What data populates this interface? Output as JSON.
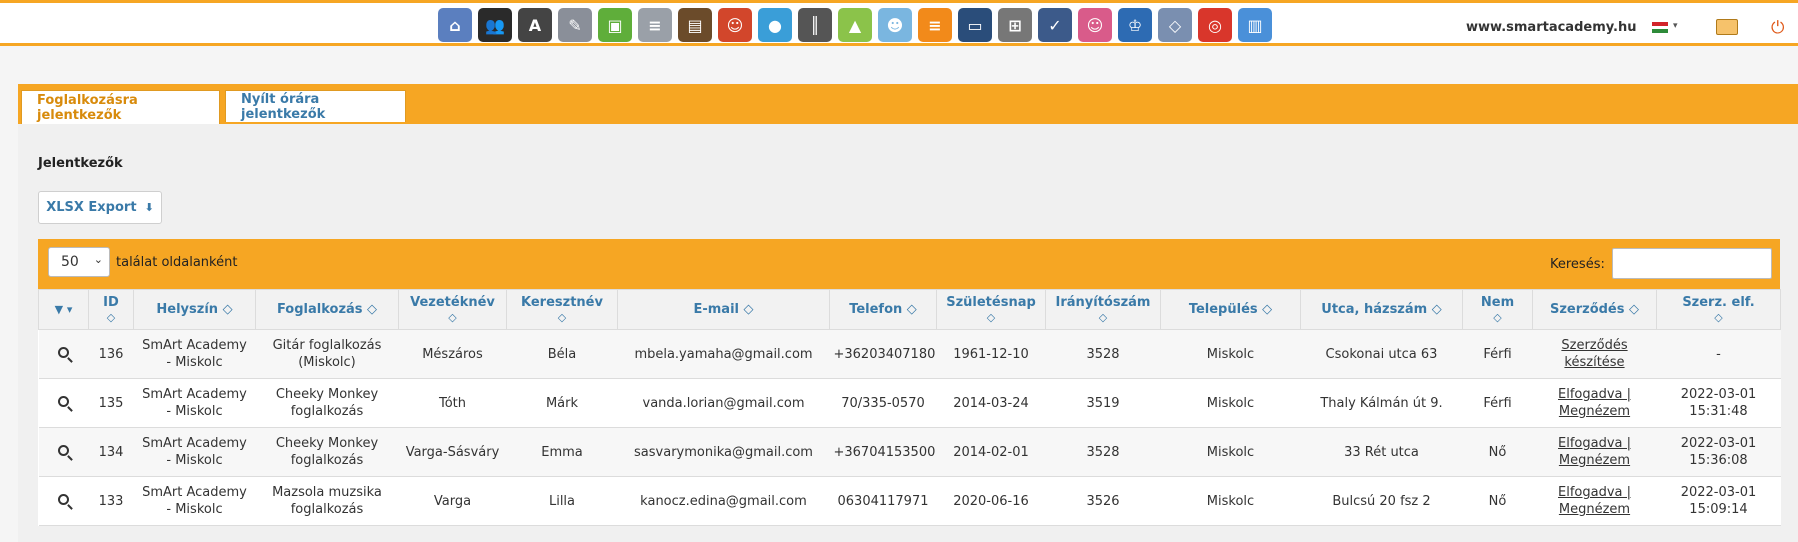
{
  "topbar": {
    "site_url": "www.smartacademy.hu",
    "icons": [
      {
        "name": "school-icon",
        "glyph": "⌂",
        "color": "#5b7fbf"
      },
      {
        "name": "group-icon",
        "glyph": "👥",
        "color": "#2a2a2a"
      },
      {
        "name": "translate-icon",
        "glyph": "A",
        "color": "#444444"
      },
      {
        "name": "notebook-icon",
        "glyph": "✎",
        "color": "#8a8f99"
      },
      {
        "name": "slides-icon",
        "glyph": "▣",
        "color": "#5fae3a"
      },
      {
        "name": "newspaper-icon",
        "glyph": "≡",
        "color": "#9aa0a8"
      },
      {
        "name": "wallet-icon",
        "glyph": "▤",
        "color": "#6b4b2a"
      },
      {
        "name": "users-icon",
        "glyph": "☺",
        "color": "#d2462b"
      },
      {
        "name": "location-pin-icon",
        "glyph": "●",
        "color": "#3a9ed8"
      },
      {
        "name": "piano-icon",
        "glyph": "║",
        "color": "#555555"
      },
      {
        "name": "landscape-icon",
        "glyph": "▲",
        "color": "#8bc34a"
      },
      {
        "name": "person-icon",
        "glyph": "☻",
        "color": "#7ab6e0"
      },
      {
        "name": "chat-icon",
        "glyph": "≡",
        "color": "#f28a1a"
      },
      {
        "name": "laptop-icon",
        "glyph": "▭",
        "color": "#2a4d7a"
      },
      {
        "name": "presentation-icon",
        "glyph": "⊞",
        "color": "#777777"
      },
      {
        "name": "checklist-icon",
        "glyph": "✓",
        "color": "#3c5a8a"
      },
      {
        "name": "kids-icon",
        "glyph": "☺",
        "color": "#d95b8a"
      },
      {
        "name": "graduation-icon",
        "glyph": "♔",
        "color": "#2d6bb3"
      },
      {
        "name": "diamond-icon",
        "glyph": "◇",
        "color": "#7a8fb0"
      },
      {
        "name": "target-icon",
        "glyph": "◎",
        "color": "#d9362b"
      },
      {
        "name": "database-icon",
        "glyph": "▥",
        "color": "#4a90d9"
      }
    ]
  },
  "tabs": [
    {
      "label": "Foglalkozásra jelentkezők",
      "active": true
    },
    {
      "label": "Nyílt órára jelentkezők",
      "active": false
    }
  ],
  "section_title": "Jelentkezők",
  "export_button": {
    "label": "XLSX Export",
    "icon": "⬇"
  },
  "table_controls": {
    "page_size": "50",
    "page_size_label": "találat oldalanként",
    "search_label": "Keresés:",
    "search_value": ""
  },
  "table": {
    "columns": [
      {
        "key": "filter",
        "label": "",
        "line2": ""
      },
      {
        "key": "id",
        "label": "ID",
        "line2": "◇"
      },
      {
        "key": "helyszin",
        "label": "Helyszín ◇",
        "line2": ""
      },
      {
        "key": "foglalkozas",
        "label": "Foglalkozás ◇",
        "line2": ""
      },
      {
        "key": "vezeteknev",
        "label": "Vezetéknév",
        "line2": "◇"
      },
      {
        "key": "keresztnev",
        "label": "Keresztnév",
        "line2": "◇"
      },
      {
        "key": "email",
        "label": "E-mail ◇",
        "line2": ""
      },
      {
        "key": "telefon",
        "label": "Telefon ◇",
        "line2": ""
      },
      {
        "key": "szuletesnap",
        "label": "Születésnap",
        "line2": "◇"
      },
      {
        "key": "iranyitoszam",
        "label": "Irányítószám",
        "line2": "◇"
      },
      {
        "key": "telepules",
        "label": "Település ◇",
        "line2": ""
      },
      {
        "key": "utca",
        "label": "Utca, házszám ◇",
        "line2": ""
      },
      {
        "key": "nem",
        "label": "Nem",
        "line2": "◇"
      },
      {
        "key": "szerzodes",
        "label": "Szerződés ◇",
        "line2": ""
      },
      {
        "key": "szerz_elf",
        "label": "Szerz. elf.",
        "line2": "◇"
      }
    ],
    "rows": [
      {
        "id": "136",
        "helyszin": [
          "SmArt Academy",
          "- Miskolc"
        ],
        "foglalkozas": [
          "Gitár foglalkozás",
          "(Miskolc)"
        ],
        "vezeteknev": "Mészáros",
        "keresztnev": "Béla",
        "email": "mbela.yamaha@gmail.com",
        "telefon": "+36203407180",
        "szuletesnap": "1961-12-10",
        "iranyitoszam": "3528",
        "telepules": "Miskolc",
        "utca": "Csokonai utca 63",
        "nem": "Férfi",
        "szerzodes": [
          "Szerződés",
          "készítése"
        ],
        "szerz_elf": [
          "-",
          ""
        ]
      },
      {
        "id": "135",
        "helyszin": [
          "SmArt Academy",
          "- Miskolc"
        ],
        "foglalkozas": [
          "Cheeky Monkey",
          "foglalkozás"
        ],
        "vezeteknev": "Tóth",
        "keresztnev": "Márk",
        "email": "vanda.lorian@gmail.com",
        "telefon": "70/335-0570",
        "szuletesnap": "2014-03-24",
        "iranyitoszam": "3519",
        "telepules": "Miskolc",
        "utca": "Thaly Kálmán út 9.",
        "nem": "Férfi",
        "szerzodes": [
          "Elfogadva |",
          "Megnézem"
        ],
        "szerz_elf": [
          "2022-03-01",
          "15:31:48"
        ]
      },
      {
        "id": "134",
        "helyszin": [
          "SmArt Academy",
          "- Miskolc"
        ],
        "foglalkozas": [
          "Cheeky Monkey",
          "foglalkozás"
        ],
        "vezeteknev": "Varga-Sásváry",
        "keresztnev": "Emma",
        "email": "sasvarymonika@gmail.com",
        "telefon": "+36704153500",
        "szuletesnap": "2014-02-01",
        "iranyitoszam": "3528",
        "telepules": "Miskolc",
        "utca": "33 Rét utca",
        "nem": "Nő",
        "szerzodes": [
          "Elfogadva |",
          "Megnézem"
        ],
        "szerz_elf": [
          "2022-03-01",
          "15:36:08"
        ]
      },
      {
        "id": "133",
        "helyszin": [
          "SmArt Academy",
          "- Miskolc"
        ],
        "foglalkozas": [
          "Mazsola muzsika",
          "foglalkozás"
        ],
        "vezeteknev": "Varga",
        "keresztnev": "Lilla",
        "email": "kanocz.edina@gmail.com",
        "telefon": "06304117971",
        "szuletesnap": "2020-06-16",
        "iranyitoszam": "3526",
        "telepules": "Miskolc",
        "utca": "Bulcsú 20 fsz 2",
        "nem": "Nő",
        "szerzodes": [
          "Elfogadva |",
          "Megnézem"
        ],
        "szerz_elf": [
          "2022-03-01",
          "15:09:14"
        ]
      }
    ]
  }
}
